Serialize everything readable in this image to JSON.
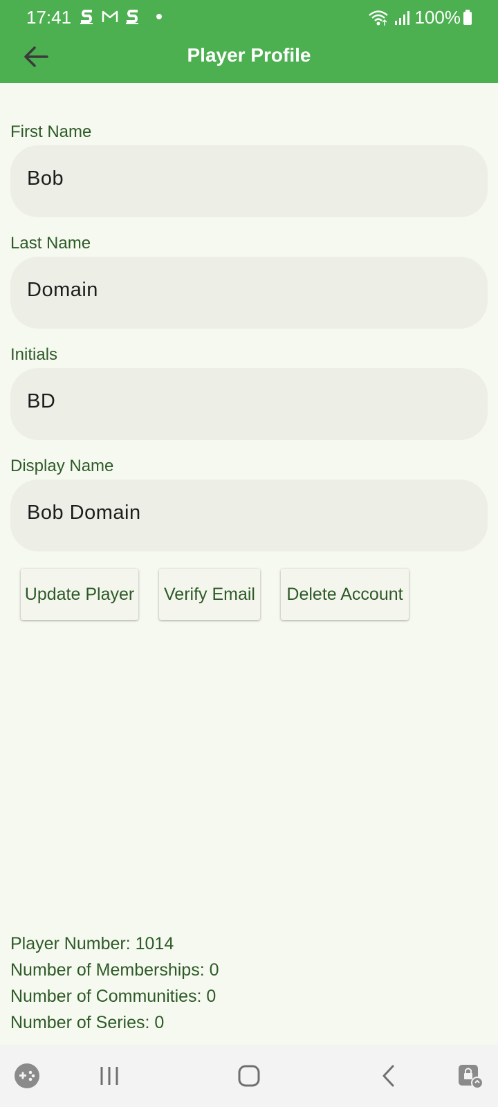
{
  "status_bar": {
    "time": "17:41",
    "battery": "100%",
    "left_icons": [
      "skype-s-icon",
      "gmail-icon",
      "skype-s-icon"
    ],
    "right_icons": [
      "wifi-icon",
      "signal-icon",
      "battery-icon"
    ]
  },
  "toolbar": {
    "title": "Player Profile",
    "back_icon": "arrow-left-icon"
  },
  "form": {
    "first_name_label": "First Name",
    "first_name_value": "Bob",
    "last_name_label": "Last Name",
    "last_name_value": "Domain",
    "initials_label": "Initials",
    "initials_value": "BD",
    "display_name_label": "Display Name",
    "display_name_value": "Bob Domain"
  },
  "actions": {
    "update_label": "Update Player",
    "verify_label": "Verify Email",
    "delete_label": "Delete Account"
  },
  "stats": {
    "player_number": "Player Number: 1014",
    "memberships": "Number of Memberships: 0",
    "communities": "Number of Communities: 0",
    "series": "Number of Series: 0"
  },
  "nav_bar": {
    "icons": [
      "game-launcher-icon",
      "recent-apps-icon",
      "home-icon",
      "back-icon",
      "secure-folder-icon"
    ]
  },
  "colors": {
    "header": "#4caf50",
    "background": "#f6f9f0",
    "field_background": "#edefe6",
    "label_text": "#2d5a27"
  }
}
